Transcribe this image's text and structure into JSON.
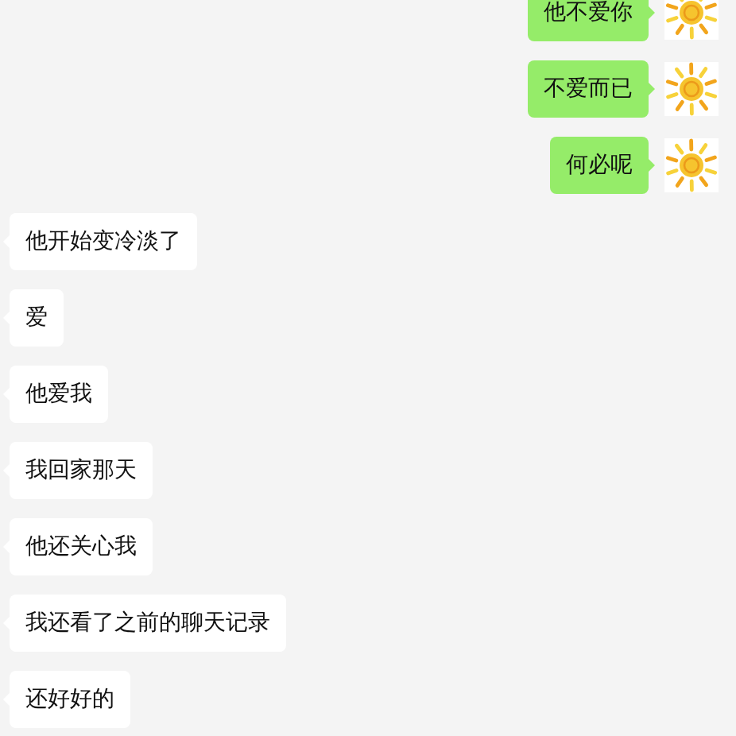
{
  "messages": [
    {
      "kind": "sent",
      "text": "他不爱你"
    },
    {
      "kind": "sent",
      "text": "不爱而已"
    },
    {
      "kind": "sent",
      "text": "何必呢"
    },
    {
      "kind": "received",
      "text": "他开始变冷淡了"
    },
    {
      "kind": "received",
      "text": "爱"
    },
    {
      "kind": "received",
      "text": "他爱我"
    },
    {
      "kind": "received",
      "text": "我回家那天"
    },
    {
      "kind": "received",
      "text": "他还关心我"
    },
    {
      "kind": "received",
      "text": "我还看了之前的聊天记录"
    },
    {
      "kind": "received",
      "text": "还好好的"
    }
  ]
}
